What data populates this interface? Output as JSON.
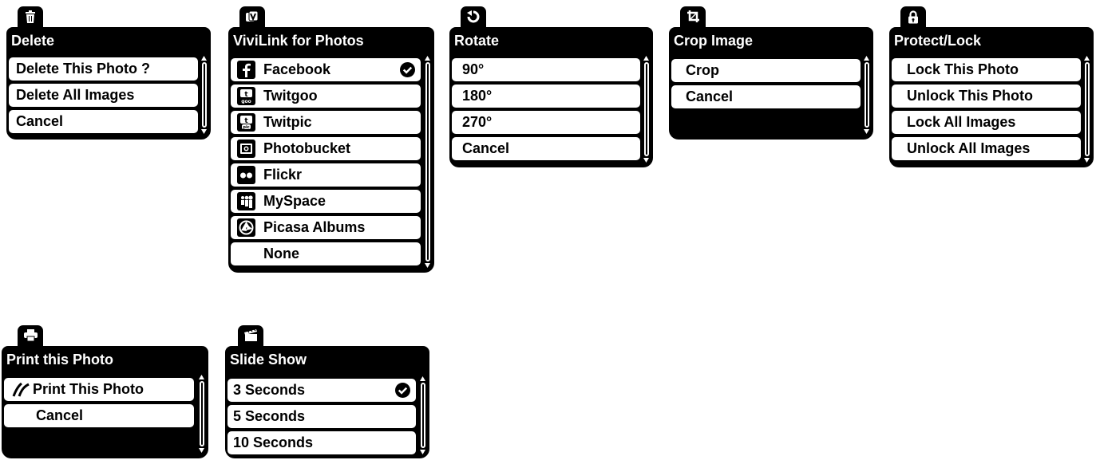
{
  "menus": {
    "delete": {
      "icon": "trash-icon",
      "title": "Delete",
      "items": [
        "Delete This Photo ?",
        "Delete All Images",
        "Cancel"
      ]
    },
    "vivilink": {
      "icon": "vivilink-icon",
      "title": "ViviLink for Photos",
      "items": [
        "Facebook",
        "Twitgoo",
        "Twitpic",
        "Photobucket",
        "Flickr",
        "MySpace",
        "Picasa Albums",
        "None"
      ],
      "item_icons": [
        "facebook-icon",
        "twitgoo-icon",
        "twitpic-icon",
        "photobucket-icon",
        "flickr-icon",
        "myspace-icon",
        "picasa-icon",
        ""
      ],
      "selected": "Facebook"
    },
    "rotate": {
      "icon": "rotate-icon",
      "title": "Rotate",
      "items": [
        "90°",
        "180°",
        "270°",
        "Cancel"
      ]
    },
    "crop": {
      "icon": "crop-icon",
      "title": "Crop Image",
      "items": [
        "Crop",
        "Cancel"
      ]
    },
    "protect": {
      "icon": "lock-icon",
      "title": "Protect/Lock",
      "items": [
        "Lock This Photo",
        "Unlock This Photo",
        "Lock All Images",
        "Unlock All Images"
      ]
    },
    "print": {
      "icon": "printer-icon",
      "title": "Print this Photo",
      "items": [
        "Print This Photo",
        "Cancel"
      ]
    },
    "slideshow": {
      "icon": "slideshow-icon",
      "title": "Slide Show",
      "items": [
        "3 Seconds",
        "5 Seconds",
        "10 Seconds"
      ],
      "selected": "3 Seconds"
    }
  },
  "colors": {
    "panel": "#000000",
    "item_bg": "#ffffff",
    "text": "#000000"
  }
}
